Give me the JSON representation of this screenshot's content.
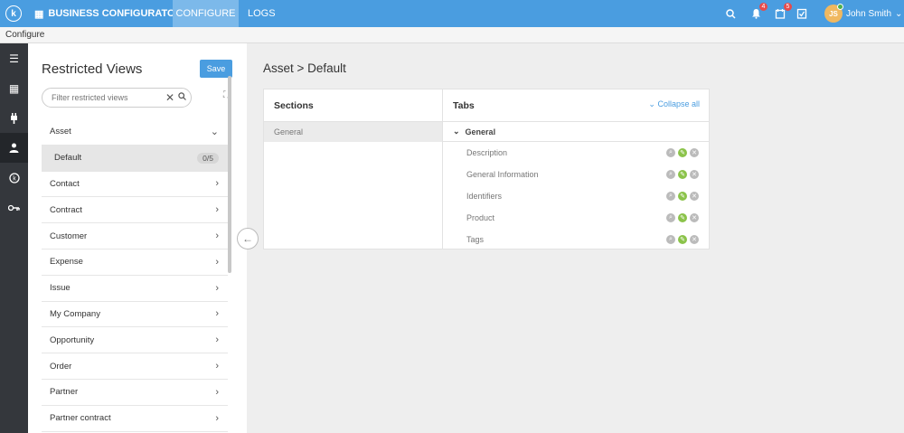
{
  "topbar": {
    "logo_glyph": "k",
    "app_name": "BUSINESS CONFIGURATOR",
    "nav": [
      "CONFIGURE",
      "LOGS"
    ],
    "notifications_count": "4",
    "tasks_count": "5",
    "user_initials": "JS",
    "user_name": "John Smith"
  },
  "subbar": {
    "breadcrumb": "Configure"
  },
  "left_panel": {
    "title": "Restricted Views",
    "save_label": "Save",
    "search_placeholder": "Filter restricted views",
    "items": [
      {
        "label": "Asset",
        "expanded": true
      },
      {
        "label": "Default",
        "count": "0/5",
        "sub": true
      },
      {
        "label": "Contact"
      },
      {
        "label": "Contract"
      },
      {
        "label": "Customer"
      },
      {
        "label": "Expense"
      },
      {
        "label": "Issue"
      },
      {
        "label": "My Company"
      },
      {
        "label": "Opportunity"
      },
      {
        "label": "Order"
      },
      {
        "label": "Partner"
      },
      {
        "label": "Partner contract"
      }
    ]
  },
  "main": {
    "breadcrumb": "Asset > Default",
    "sections_header": "Sections",
    "sections": [
      "General"
    ],
    "tabs_header": "Tabs",
    "collapse_all": "Collapse all",
    "group": "General",
    "tabs": [
      "Description",
      "General Information",
      "Identifiers",
      "Product",
      "Tags"
    ]
  },
  "colors": {
    "accent": "#4a9de0",
    "rail": "#34373c",
    "edit": "#8bc34a",
    "badge": "#e64a4a"
  }
}
